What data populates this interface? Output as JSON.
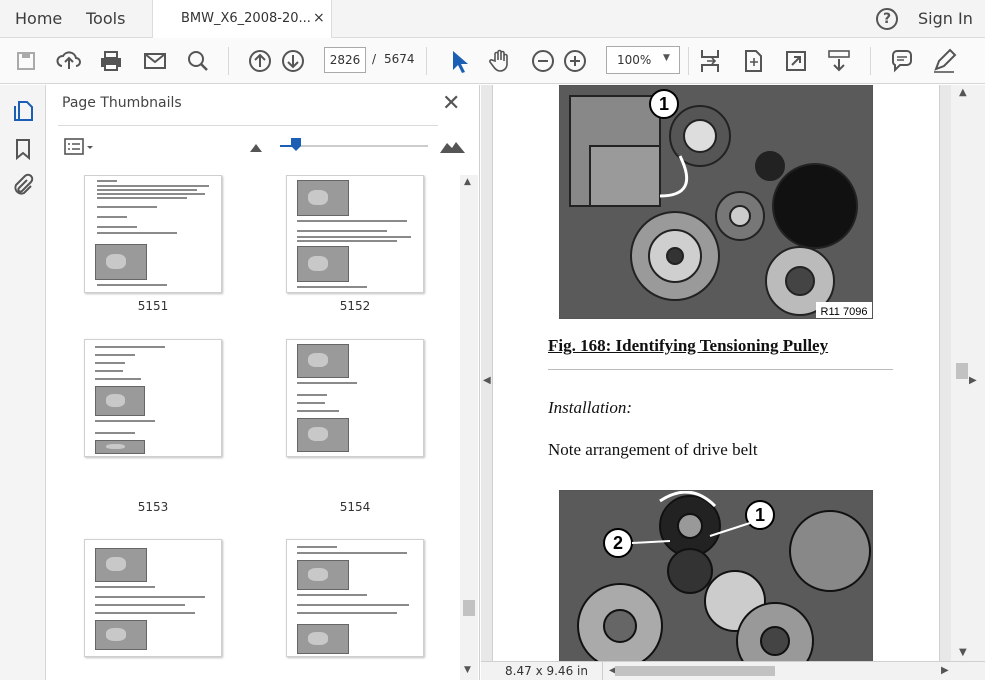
{
  "menu": {
    "home": "Home",
    "tools": "Tools",
    "sign_in": "Sign In"
  },
  "tab": {
    "title": "BMW_X6_2008-20...",
    "close": "×"
  },
  "help": "?",
  "toolbar": {
    "page_current": "2826",
    "page_separator": "/",
    "page_total": "5674",
    "zoom": "100%",
    "zoom_caret": "▼",
    "icons": [
      "save-icon",
      "upload-icon",
      "print-icon",
      "email-icon",
      "search-icon",
      "page-up-icon",
      "page-down-icon",
      "select-arrow-icon",
      "hand-icon",
      "zoom-out-icon",
      "zoom-in-icon",
      "fit-page-icon",
      "fit-width-icon",
      "fullscreen-icon",
      "scroll-mode-icon",
      "comment-icon",
      "pen-icon"
    ]
  },
  "thumbnails_panel": {
    "title": "Page Thumbnails",
    "close": "✕",
    "pages": [
      {
        "number": "5151"
      },
      {
        "number": "5152"
      },
      {
        "number": "5153"
      },
      {
        "number": "5154"
      },
      {
        "number": ""
      },
      {
        "number": ""
      }
    ]
  },
  "document": {
    "fig1_label": "1",
    "fig1_code": "R11 7096",
    "caption": "Fig. 168: Identifying Tensioning Pulley",
    "installation": "Installation:",
    "note": "Note arrangement of drive belt",
    "fig2_label_1": "1",
    "fig2_label_2": "2"
  },
  "status": {
    "page_size": "8.47 x 9.46 in"
  }
}
